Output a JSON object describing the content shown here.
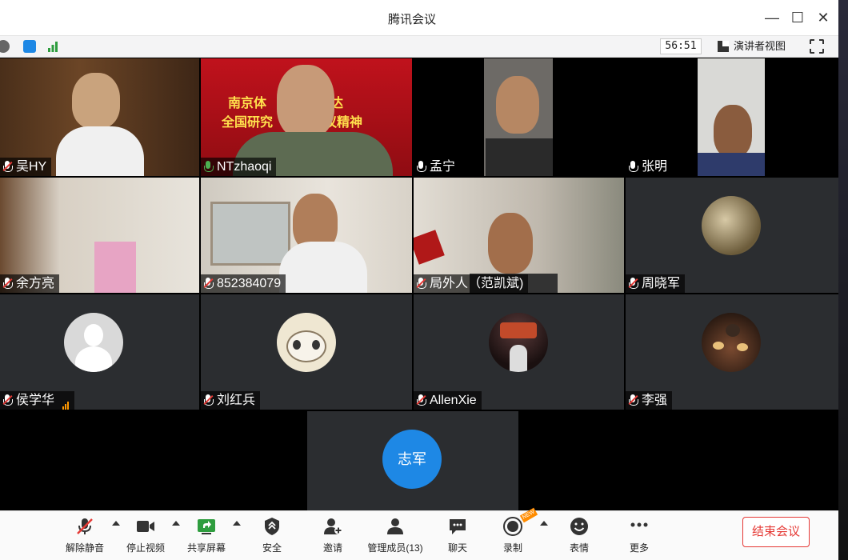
{
  "window": {
    "title": "腾讯会议"
  },
  "infobar": {
    "timer": "56:51",
    "speaker_view_label": "演讲者视图"
  },
  "banner": {
    "line1": "南京体　　　习传达",
    "line2": "全国研究　　　会议精神"
  },
  "participants": [
    {
      "name": "吴HY",
      "mic": "muted",
      "video": true
    },
    {
      "name": "NTzhaoqi",
      "mic": "on",
      "video": true
    },
    {
      "name": "孟宁",
      "mic": "on",
      "video": true
    },
    {
      "name": "张明",
      "mic": "on",
      "video": true
    },
    {
      "name": "余方亮",
      "mic": "muted",
      "video": true
    },
    {
      "name": "852384079",
      "mic": "muted",
      "video": true
    },
    {
      "name": "局外人（范凯斌)",
      "mic": "muted",
      "video": true
    },
    {
      "name": "周晓军",
      "mic": "muted",
      "video": false
    },
    {
      "name": "侯学华",
      "mic": "muted",
      "video": false
    },
    {
      "name": "刘红兵",
      "mic": "muted",
      "video": false
    },
    {
      "name": "AllenXie",
      "mic": "muted",
      "video": false
    },
    {
      "name": "李强",
      "mic": "muted",
      "video": false
    },
    {
      "name": "志军",
      "mic": "none",
      "video": false
    }
  ],
  "toolbar": {
    "unmute": "解除静音",
    "stop_video": "停止视频",
    "share_screen": "共享屏幕",
    "security": "安全",
    "invite": "邀请",
    "manage_members": "管理成员(13)",
    "chat": "聊天",
    "record": "录制",
    "reactions": "表情",
    "more": "更多",
    "end_meeting": "结束会议",
    "new_badge": "NEW"
  },
  "colors": {
    "accent_blue": "#1e88e5",
    "end_red": "#e53935",
    "mute_red": "#e53935",
    "mic_green": "#4caf50"
  }
}
